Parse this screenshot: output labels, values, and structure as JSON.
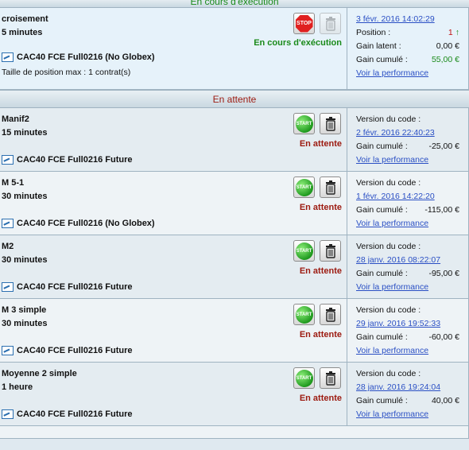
{
  "sections": {
    "running_title": "En cours d'exécution",
    "waiting_title": "En attente"
  },
  "running": {
    "name": "croisement",
    "period": "5 minutes",
    "market": "CAC40 FCE Full0216 (No Globex)",
    "max_position": "Taille de position max : 1 contrat(s)",
    "state": "En cours d'exécution",
    "stop_label": "STOP",
    "date": "3 févr. 2016 14:02:29",
    "position_label": "Position :",
    "position_value": "1",
    "gain_latent_label": "Gain latent :",
    "gain_latent_value": "0,00 €",
    "gain_cumule_label": "Gain cumulé :",
    "gain_cumule_value": "55,00 €",
    "perf_link": "Voir la performance"
  },
  "waiting": [
    {
      "name": "Manif2",
      "period": "15 minutes",
      "market": "CAC40 FCE Full0216 Future",
      "state": "En attente",
      "start_label": "START",
      "version_label": "Version du code :",
      "version_date": "2 févr. 2016 22:40:23",
      "gain_cumule_label": "Gain cumulé :",
      "gain_cumule_value": "-25,00 €",
      "perf_link": "Voir la performance"
    },
    {
      "name": "M 5-1",
      "period": "30 minutes",
      "market": "CAC40 FCE Full0216 (No Globex)",
      "state": "En attente",
      "start_label": "START",
      "version_label": "Version du code :",
      "version_date": "1 févr. 2016 14:22:20",
      "gain_cumule_label": "Gain cumulé :",
      "gain_cumule_value": "-115,00 €",
      "perf_link": "Voir la performance"
    },
    {
      "name": "M2",
      "period": "30 minutes",
      "market": "CAC40 FCE Full0216 Future",
      "state": "En attente",
      "start_label": "START",
      "version_label": "Version du code :",
      "version_date": "28 janv. 2016 08:22:07",
      "gain_cumule_label": "Gain cumulé :",
      "gain_cumule_value": "-95,00 €",
      "perf_link": "Voir la performance"
    },
    {
      "name": "M 3 simple",
      "period": "30 minutes",
      "market": "CAC40 FCE Full0216 Future",
      "state": "En attente",
      "start_label": "START",
      "version_label": "Version du code :",
      "version_date": "29 janv. 2016 19:52:33",
      "gain_cumule_label": "Gain cumulé :",
      "gain_cumule_value": "-60,00 €",
      "perf_link": "Voir la performance"
    },
    {
      "name": "Moyenne 2 simple",
      "period": "1 heure",
      "market": "CAC40 FCE Full0216 Future",
      "state": "En attente",
      "start_label": "START",
      "version_label": "Version du code :",
      "version_date": "28 janv. 2016 19:24:04",
      "gain_cumule_label": "Gain cumulé :",
      "gain_cumule_value": "40,00 €",
      "perf_link": "Voir la performance"
    }
  ],
  "icons": {
    "market": "market-chart-icon",
    "stop": "stop-sign-icon",
    "start": "start-button-icon",
    "trash": "trash-icon",
    "position_up": "arrow-up-icon"
  },
  "colors": {
    "running_green": "#1a8a1a",
    "waiting_red": "#9c1a10",
    "link_blue": "#2a4fc4"
  }
}
